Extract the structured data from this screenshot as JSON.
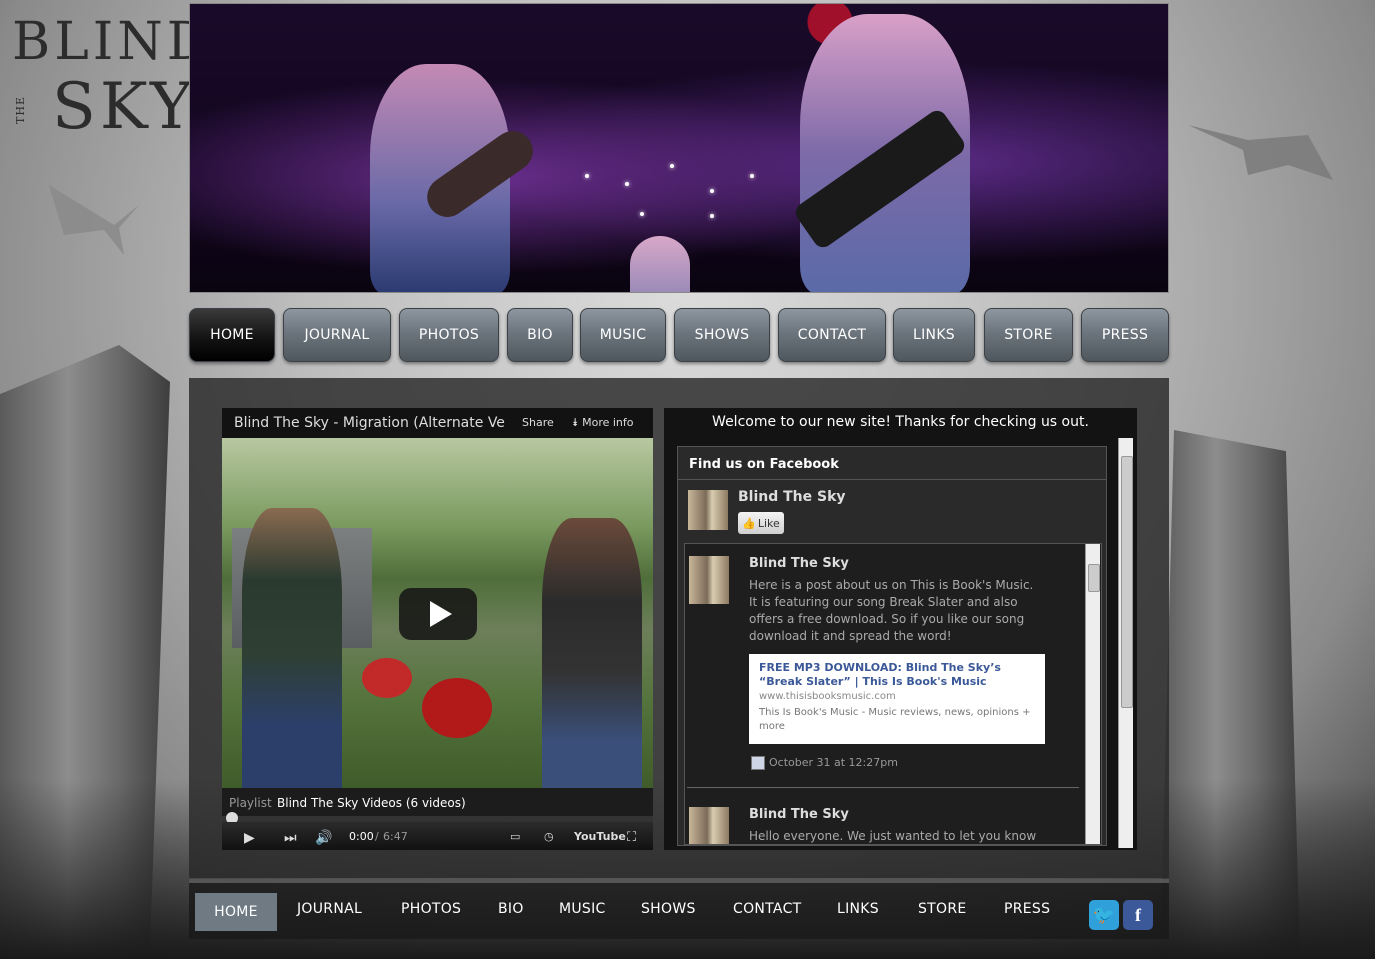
{
  "logo": {
    "word1": "BLIND",
    "word2": "THE",
    "word3": "SKY"
  },
  "nav": [
    {
      "label": "HOME",
      "active": true
    },
    {
      "label": "JOURNAL"
    },
    {
      "label": "PHOTOS"
    },
    {
      "label": "BIO"
    },
    {
      "label": "MUSIC"
    },
    {
      "label": "SHOWS"
    },
    {
      "label": "CONTACT"
    },
    {
      "label": "LINKS"
    },
    {
      "label": "STORE"
    },
    {
      "label": "PRESS"
    }
  ],
  "video": {
    "title": "Blind The Sky - Migration (Alternate Ve",
    "share": "Share",
    "more_info": "More info",
    "playlist_label": "Playlist",
    "playlist_name": "Blind The Sky Videos (6 videos)",
    "time_current": "0:00",
    "time_sep": "/",
    "time_total": "6:47",
    "youtube": "YouTube"
  },
  "welcome": "Welcome to our new site! Thanks for checking us out.",
  "facebook": {
    "header": "Find us on Facebook",
    "page_name": "Blind The Sky",
    "like_label": "Like",
    "posts": [
      {
        "author": "Blind The Sky",
        "text": "Here is a post about us on This is Book's Music. It is featuring our song Break Slater and also offers a free download. So if you like our song download it and spread the word!",
        "link_title": "FREE MP3 DOWNLOAD: Blind The Sky’s “Break Slater” | This Is Book's Music",
        "link_url": "www.thisisbooksmusic.com",
        "link_desc": "This Is Book's Music - Music reviews, news, opinions + more",
        "date": "October 31 at 12:27pm"
      },
      {
        "author": "Blind The Sky",
        "text": "Hello everyone. We just wanted to let you know"
      }
    ]
  },
  "footer_nav": [
    "HOME",
    "JOURNAL",
    "PHOTOS",
    "BIO",
    "MUSIC",
    "SHOWS",
    "CONTACT",
    "LINKS",
    "STORE",
    "PRESS"
  ],
  "social": {
    "twitter_icon": "twitter-icon",
    "facebook_icon": "facebook-icon",
    "twitter_color": "#2fa0da",
    "facebook_color": "#3b5998"
  }
}
